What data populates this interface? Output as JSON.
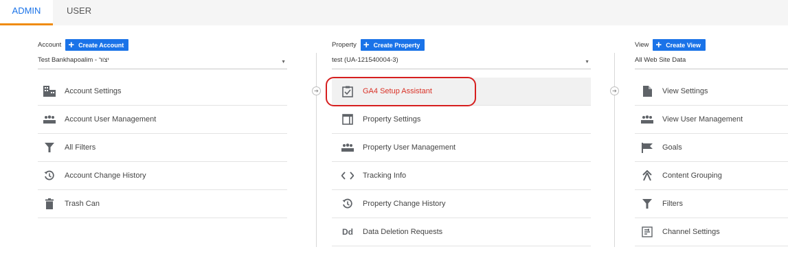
{
  "tabs": {
    "admin": "ADMIN",
    "user": "USER"
  },
  "colors": {
    "accent_blue": "#1a73e8",
    "tab_underline": "#ef8b0c",
    "highlight_red": "#d61e1e",
    "active_text": "#d93025"
  },
  "account": {
    "label": "Account",
    "create_label": "Create Account",
    "selected": "Test Bankhapoalim - יצור",
    "items": [
      {
        "label": "Account Settings",
        "icon": "building-icon"
      },
      {
        "label": "Account User Management",
        "icon": "people-icon"
      },
      {
        "label": "All Filters",
        "icon": "filter-icon"
      },
      {
        "label": "Account Change History",
        "icon": "history-icon"
      },
      {
        "label": "Trash Can",
        "icon": "trash-icon"
      }
    ]
  },
  "property": {
    "label": "Property",
    "create_label": "Create Property",
    "selected": "test (UA-121540004-3)",
    "items": [
      {
        "label": "GA4 Setup Assistant",
        "icon": "checkbox-icon"
      },
      {
        "label": "Property Settings",
        "icon": "window-icon"
      },
      {
        "label": "Property User Management",
        "icon": "people-icon"
      },
      {
        "label": "Tracking Info",
        "icon": "code-icon"
      },
      {
        "label": "Property Change History",
        "icon": "history-icon"
      },
      {
        "label": "Data Deletion Requests",
        "icon": "dd-icon"
      }
    ]
  },
  "view": {
    "label": "View",
    "create_label": "Create View",
    "selected": "All Web Site Data",
    "items": [
      {
        "label": "View Settings",
        "icon": "document-icon"
      },
      {
        "label": "View User Management",
        "icon": "people-icon"
      },
      {
        "label": "Goals",
        "icon": "flag-icon"
      },
      {
        "label": "Content Grouping",
        "icon": "person-walk-icon"
      },
      {
        "label": "Filters",
        "icon": "filter-icon"
      },
      {
        "label": "Channel Settings",
        "icon": "channel-icon"
      }
    ]
  }
}
